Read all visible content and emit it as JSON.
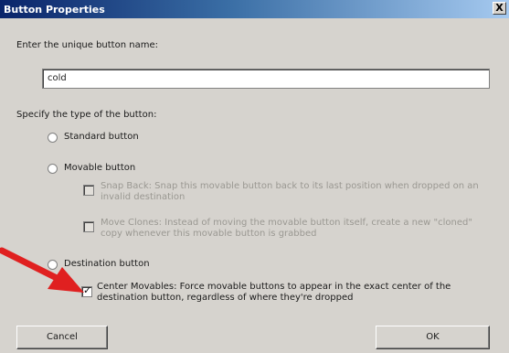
{
  "window": {
    "title": "Button Properties",
    "close_glyph": "X"
  },
  "name_prompt": "Enter the unique button name:",
  "name_input": {
    "value": "cold"
  },
  "type_prompt": "Specify the type of the button:",
  "options": {
    "standard": "Standard button",
    "movable": "Movable button",
    "destination": "Destination button"
  },
  "movable_options": {
    "snap_back": "Snap Back: Snap this movable button back to its last position when dropped on an invalid destination",
    "move_clones": "Move Clones: Instead of moving the movable button itself, create a new \"cloned\" copy whenever this movable button is grabbed"
  },
  "destination_options": {
    "center_movables": "Center Movables: Force movable buttons to appear in the exact center of the destination button, regardless of where they're dropped",
    "center_movables_checked": true
  },
  "buttons": {
    "cancel": "Cancel",
    "ok": "OK"
  },
  "annotation": {
    "arrow_color": "#e02020"
  }
}
